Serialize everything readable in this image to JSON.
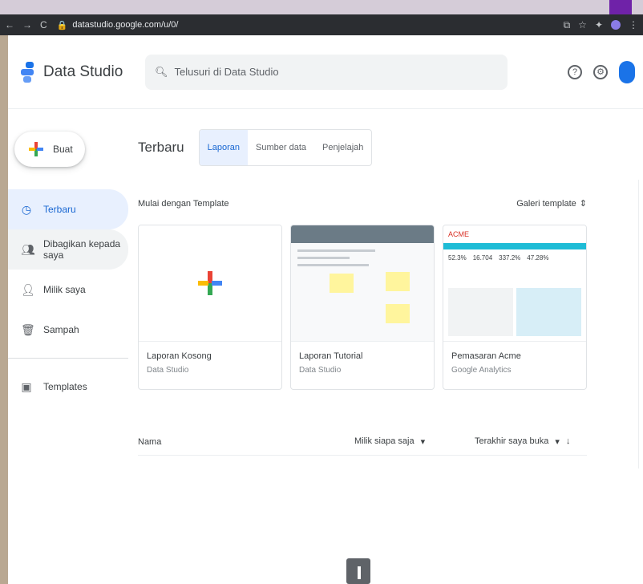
{
  "browser": {
    "nav_back": "←",
    "nav_forward": "→",
    "reload": "C",
    "url": "datastudio.google.com/u/0/",
    "right_icons": [
      "share-icon",
      "star-icon",
      "extension-icon",
      "profile-icon",
      "menu-icon"
    ]
  },
  "header": {
    "app_name": "Data Studio",
    "search_placeholder": "Telusuri di Data Studio",
    "icons": [
      "help-icon",
      "settings-icon",
      "account-avatar"
    ]
  },
  "sidebar": {
    "create_label": "Buat",
    "items": [
      {
        "label": "Terbaru",
        "icon": "clock-icon"
      },
      {
        "label": "Dibagikan kepada saya",
        "icon": "people-icon"
      },
      {
        "label": "Milik saya",
        "icon": "person-icon"
      },
      {
        "label": "Sampah",
        "icon": "trash-icon"
      },
      {
        "label": "Templates",
        "icon": "template-icon"
      }
    ]
  },
  "main": {
    "section_title": "Terbaru",
    "tabs": [
      "Laporan",
      "Sumber data",
      "Penjelajah"
    ],
    "template_heading": "Mulai dengan Template",
    "gallery_label": "Galeri template",
    "cards": [
      {
        "title": "Laporan Kosong",
        "subtitle": "Data Studio"
      },
      {
        "title": "Laporan Tutorial",
        "subtitle": "Data Studio"
      },
      {
        "title": "Pemasaran Acme",
        "subtitle": "Google Analytics"
      }
    ],
    "acme": {
      "logo": "ACME",
      "metrics": [
        "52.3%",
        "16.704",
        "337.2%",
        "47.28%"
      ]
    },
    "list_columns": {
      "name": "Nama",
      "owner": "Milik siapa saja",
      "opened": "Terakhir saya buka"
    }
  },
  "colors": {
    "accent": "#1a73e8",
    "active_bg": "#e8f0fe",
    "chrome_bg": "#2b2d31"
  }
}
